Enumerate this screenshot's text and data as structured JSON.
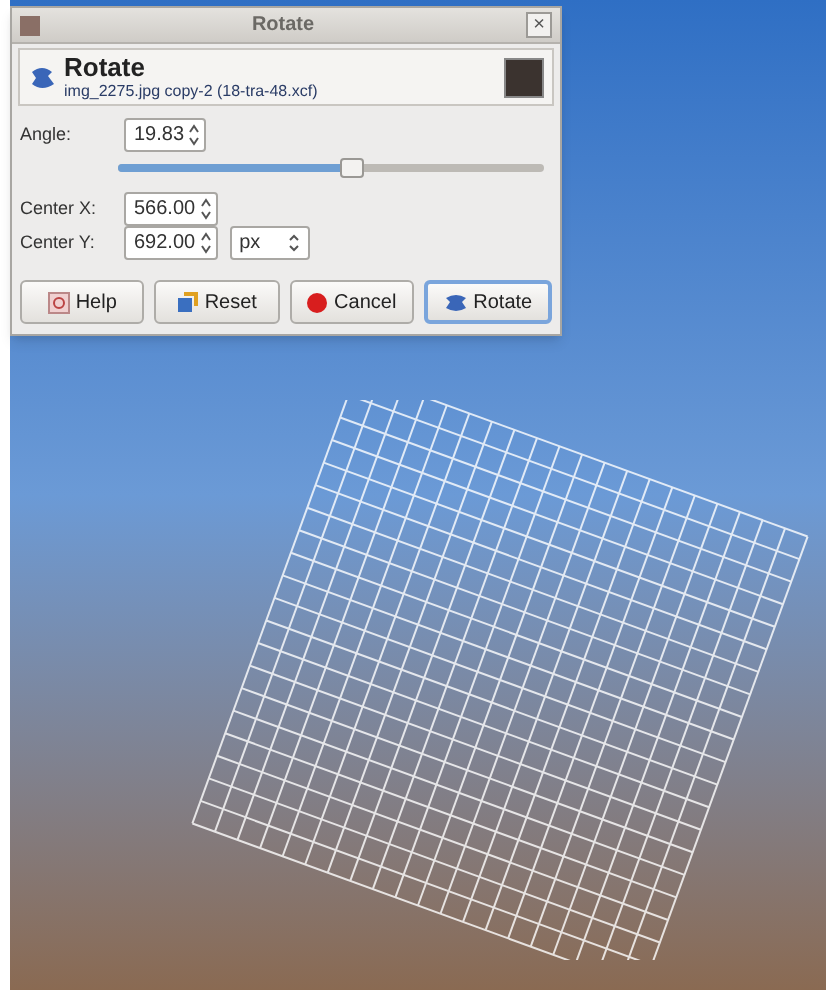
{
  "window": {
    "title": "Rotate",
    "close": "×"
  },
  "header": {
    "title": "Rotate",
    "subtitle": "img_2275.jpg copy-2 (18-tra-48.xcf)"
  },
  "angle": {
    "label": "Angle:",
    "value": "19.83",
    "level": 0.55
  },
  "center_x": {
    "label": "Center X:",
    "value": "566.00"
  },
  "center_y": {
    "label": "Center Y:",
    "value": "692.00",
    "unit": "px"
  },
  "buttons": [
    {
      "label": "Help",
      "kind": "help",
      "selected": false
    },
    {
      "label": "Reset",
      "kind": "reset",
      "selected": false
    },
    {
      "label": "Cancel",
      "kind": "cancel",
      "selected": false
    },
    {
      "label": "Rotate",
      "kind": "rotate",
      "selected": true
    }
  ]
}
